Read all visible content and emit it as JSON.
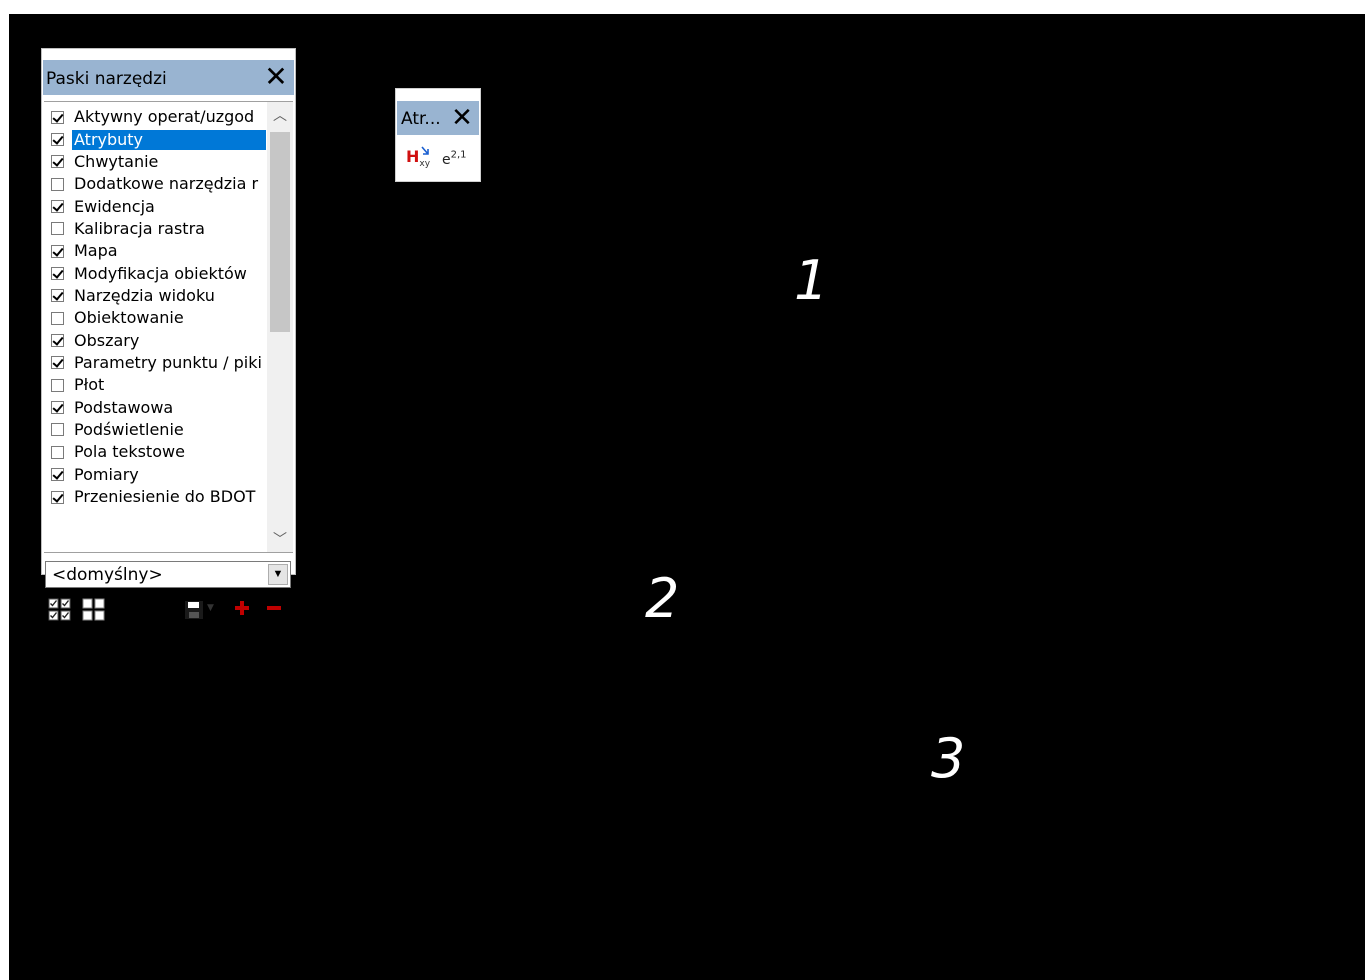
{
  "toolbars_panel": {
    "title": "Paski narzędzi",
    "close_glyph": "✕",
    "items": [
      {
        "label": "Aktywny operat/uzgod",
        "checked": true,
        "selected": false
      },
      {
        "label": "Atrybuty",
        "checked": true,
        "selected": true
      },
      {
        "label": "Chwytanie",
        "checked": true,
        "selected": false
      },
      {
        "label": "Dodatkowe narzędzia r",
        "checked": false,
        "selected": false
      },
      {
        "label": "Ewidencja",
        "checked": true,
        "selected": false
      },
      {
        "label": "Kalibracja rastra",
        "checked": false,
        "selected": false
      },
      {
        "label": "Mapa",
        "checked": true,
        "selected": false
      },
      {
        "label": "Modyfikacja obiektów",
        "checked": true,
        "selected": false
      },
      {
        "label": "Narzędzia widoku",
        "checked": true,
        "selected": false
      },
      {
        "label": "Obiektowanie",
        "checked": false,
        "selected": false
      },
      {
        "label": "Obszary",
        "checked": true,
        "selected": false
      },
      {
        "label": "Parametry punktu / piki",
        "checked": true,
        "selected": false
      },
      {
        "label": "Płot",
        "checked": false,
        "selected": false
      },
      {
        "label": "Podstawowa",
        "checked": true,
        "selected": false
      },
      {
        "label": "Podświetlenie",
        "checked": false,
        "selected": false
      },
      {
        "label": "Pola tekstowe",
        "checked": false,
        "selected": false
      },
      {
        "label": "Pomiary",
        "checked": true,
        "selected": false
      },
      {
        "label": "Przeniesienie do BDOT",
        "checked": true,
        "selected": false
      }
    ],
    "profile_value": "<domyślny>",
    "selection_color": "#0078d7",
    "title_bar_color": "#99b4d1"
  },
  "attributes_toolbar": {
    "title": "Atr...",
    "close_glyph": "✕",
    "tool1_main": "H",
    "tool1_sub": "xy",
    "tool2_main": "e",
    "tool2_sup": "2,1"
  },
  "canvas": {
    "background": "#000000",
    "labels": [
      "1",
      "2",
      "3"
    ]
  }
}
